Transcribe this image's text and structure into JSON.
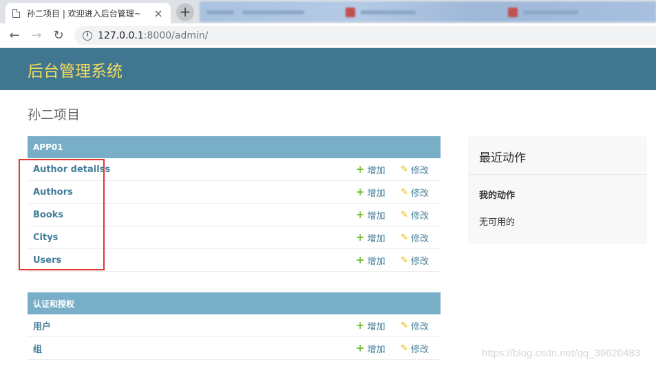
{
  "browser": {
    "active_tab_title": "孙二项目 | 欢迎进入后台管理~",
    "close_glyph": "×",
    "new_tab_glyph": "+",
    "url_host": "127.0.0.1",
    "url_rest": ":8000/admin/"
  },
  "header": {
    "branding": "后台管理系统"
  },
  "page_title": "孙二项目",
  "modules": [
    {
      "caption": "APP01",
      "models": [
        {
          "name": "Author detailss",
          "add": "增加",
          "change": "修改"
        },
        {
          "name": "Authors",
          "add": "增加",
          "change": "修改"
        },
        {
          "name": "Books",
          "add": "增加",
          "change": "修改"
        },
        {
          "name": "Citys",
          "add": "增加",
          "change": "修改"
        },
        {
          "name": "Users",
          "add": "增加",
          "change": "修改"
        }
      ]
    },
    {
      "caption": "认证和授权",
      "models": [
        {
          "name": "用户",
          "add": "增加",
          "change": "修改"
        },
        {
          "name": "组",
          "add": "增加",
          "change": "修改"
        }
      ]
    }
  ],
  "recent_actions": {
    "title": "最近动作",
    "my_actions": "我的动作",
    "none_available": "无可用的"
  },
  "watermark": "https://blog.csdn.net/qq_39620483",
  "colors": {
    "header_bg": "#417690",
    "branding": "#f5dd5d",
    "caption_bg": "#79aec8",
    "link": "#447e9b",
    "add_icon": "#70bf2b",
    "change_icon": "#efb80b",
    "highlight": "#e0372e"
  }
}
